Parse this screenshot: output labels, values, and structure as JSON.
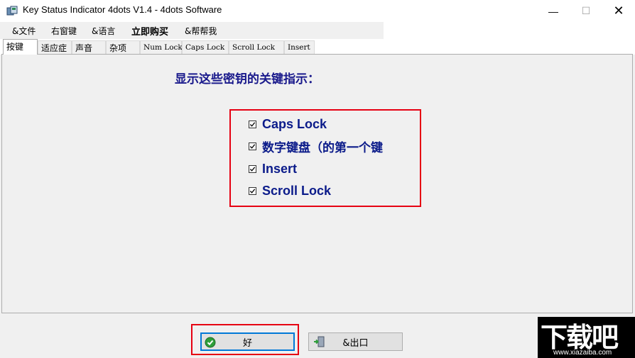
{
  "window": {
    "title": "Key Status Indicator 4dots V1.4 - 4dots Software",
    "controls": {
      "minimize": "—",
      "maximize": "☐",
      "close": "✕"
    }
  },
  "menu": {
    "items": [
      {
        "label": "&文件"
      },
      {
        "label": "右窗键"
      },
      {
        "label": "&语言"
      },
      {
        "label": "立即购买"
      },
      {
        "label": "&帮帮我"
      }
    ]
  },
  "tabs": [
    {
      "label": "按键"
    },
    {
      "label": "适应症"
    },
    {
      "label": "声音"
    },
    {
      "label": "杂项"
    },
    {
      "label": "Num Lock"
    },
    {
      "label": "Caps Lock"
    },
    {
      "label": "Scroll Lock"
    },
    {
      "label": "Insert"
    }
  ],
  "panel": {
    "heading": "显示这些密钥的关键指示：",
    "options": [
      {
        "label": "Caps Lock",
        "checked": true
      },
      {
        "label": "数字键盘（的第一个键",
        "checked": true
      },
      {
        "label": "Insert",
        "checked": true
      },
      {
        "label": "Scroll Lock",
        "checked": true
      }
    ]
  },
  "buttons": {
    "ok": "好",
    "exit": "&出口"
  },
  "watermark": {
    "logo": "下载吧",
    "url": "www.xiazaiba.com"
  },
  "colors": {
    "heading": "#1a1a8c",
    "option_text": "#0b1b8a",
    "highlight_box": "#e60012",
    "ok_focus": "#0078d7"
  }
}
